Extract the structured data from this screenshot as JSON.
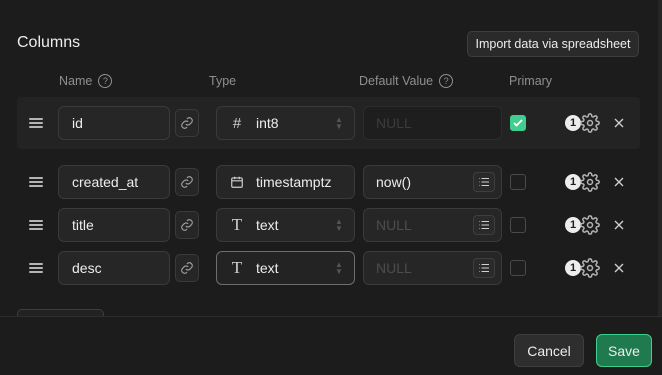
{
  "section_title": "Columns",
  "import_button": "Import data via spreadsheet",
  "headers": {
    "name": "Name",
    "type": "Type",
    "default_value": "Default Value",
    "primary": "Primary",
    "help_glyph": "?"
  },
  "rows": [
    {
      "name": "id",
      "type": "int8",
      "type_icon": "hash-icon",
      "default": "NULL",
      "default_is_placeholder": true,
      "primary": true,
      "badge": "1"
    },
    {
      "name": "created_at",
      "type": "timestamptz",
      "type_icon": "calendar-icon",
      "default": "now()",
      "default_is_placeholder": false,
      "primary": false,
      "badge": "1"
    },
    {
      "name": "title",
      "type": "text",
      "type_icon": "text-type-icon",
      "default": "NULL",
      "default_is_placeholder": true,
      "primary": false,
      "badge": "1"
    },
    {
      "name": "desc",
      "type": "text",
      "type_icon": "text-type-icon",
      "default": "NULL",
      "default_is_placeholder": true,
      "primary": false,
      "badge": "1"
    }
  ],
  "glyphs": {
    "hash": "#",
    "text_type": "T"
  },
  "footer": {
    "cancel": "Cancel",
    "save": "Save"
  },
  "colors": {
    "accent": "#3ecf8e",
    "save_bg": "#1f7a4d",
    "background": "#1c1c1c"
  }
}
